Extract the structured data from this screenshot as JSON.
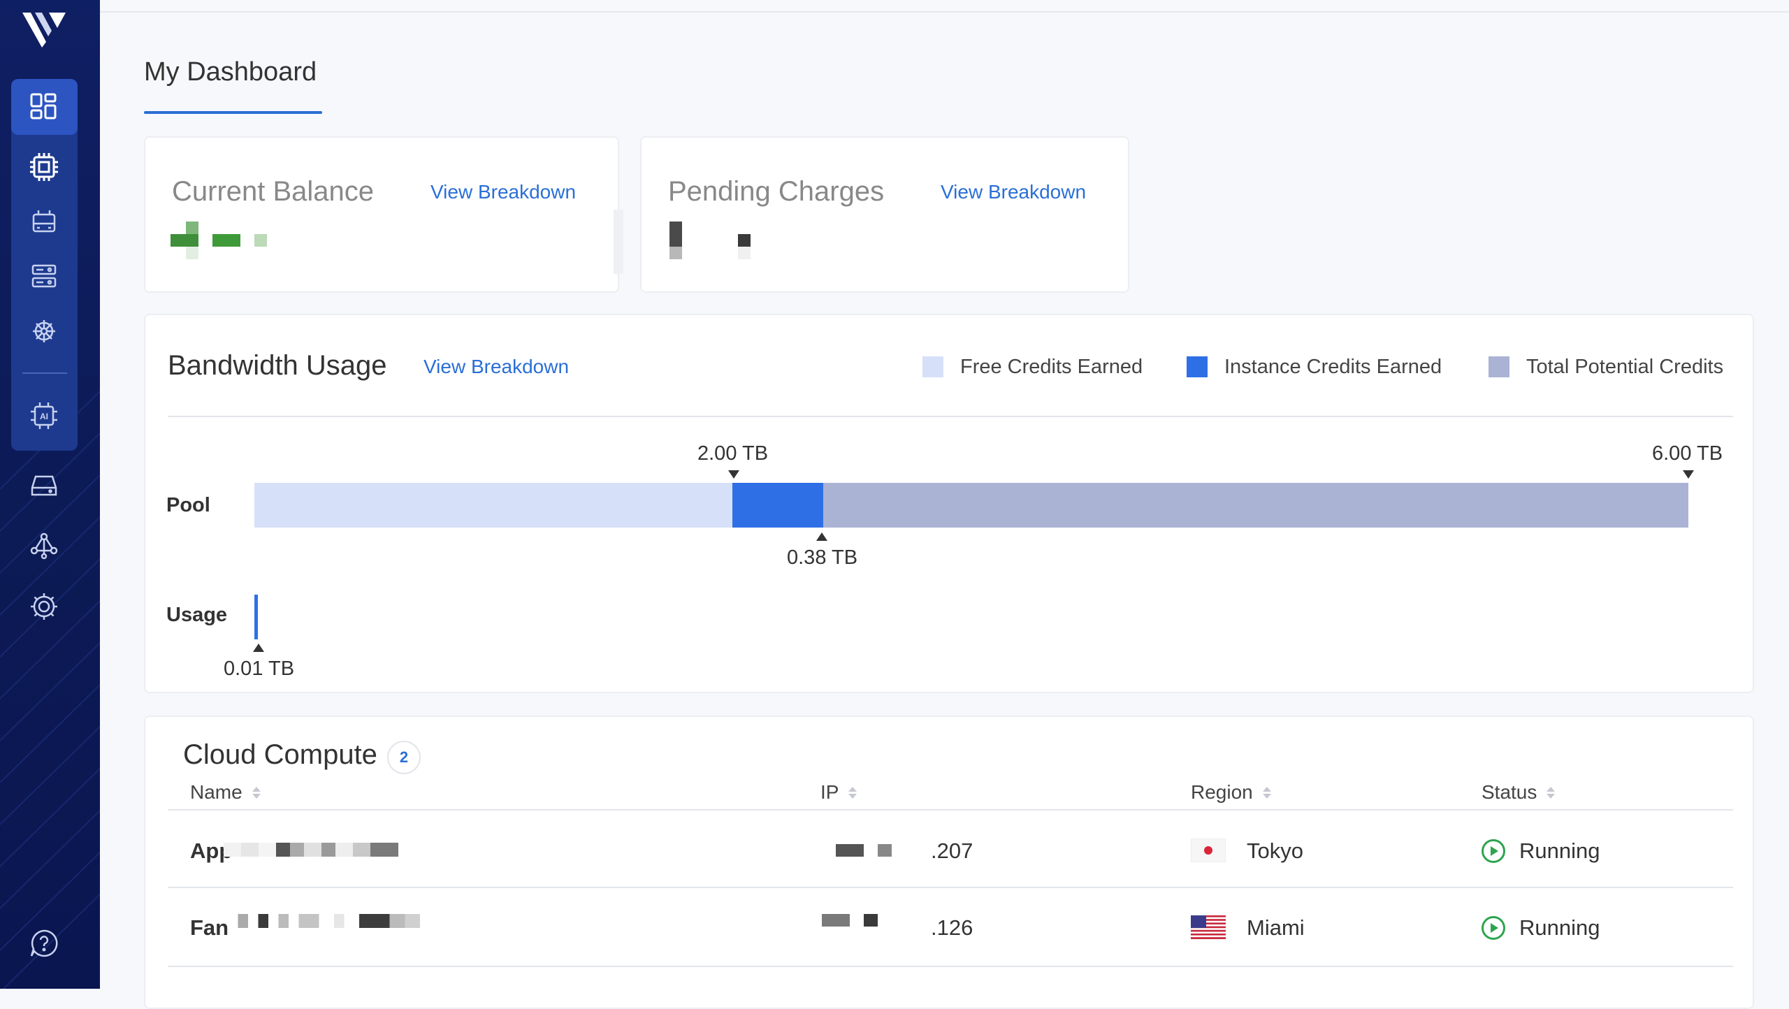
{
  "sidebar": {
    "logo": "vultr-logo",
    "items": [
      {
        "icon": "dashboard-icon",
        "active": true
      },
      {
        "icon": "cpu-icon"
      },
      {
        "icon": "server-icon"
      },
      {
        "icon": "database-icon"
      },
      {
        "icon": "kubernetes-icon"
      },
      {
        "icon": "ai-chip-icon"
      },
      {
        "icon": "storage-icon"
      },
      {
        "icon": "network-icon"
      },
      {
        "icon": "settings-icon"
      },
      {
        "icon": "help-icon"
      }
    ],
    "colors": {
      "background": "#0f1f63",
      "group": "#1d3a8f",
      "active": "#2c55c2"
    }
  },
  "page": {
    "tab_title": "My Dashboard"
  },
  "balance_card": {
    "title": "Current Balance",
    "link": "View Breakdown"
  },
  "pending_card": {
    "title": "Pending Charges",
    "link": "View Breakdown"
  },
  "bandwidth": {
    "title": "Bandwidth Usage",
    "link": "View Breakdown",
    "legend": [
      {
        "label": "Free Credits Earned",
        "color": "#d6e0f8"
      },
      {
        "label": "Instance Credits Earned",
        "color": "#2f6fe6"
      },
      {
        "label": "Total Potential Credits",
        "color": "#aab3d4"
      }
    ],
    "pool_label": "Pool",
    "usage_label": "Usage",
    "marker_free": "2.00 TB",
    "marker_instance": "0.38 TB",
    "marker_total": "6.00 TB",
    "marker_usage": "0.01 TB"
  },
  "chart_data": {
    "type": "bar",
    "orientation": "horizontal",
    "unit": "TB",
    "categories": [
      "Pool",
      "Usage"
    ],
    "series": [
      {
        "name": "Free Credits Earned",
        "values": [
          2.0,
          null
        ]
      },
      {
        "name": "Instance Credits Earned",
        "values": [
          0.38,
          null
        ]
      },
      {
        "name": "Total Potential Credits",
        "values": [
          6.0,
          null
        ]
      },
      {
        "values": [
          null,
          0.01
        ]
      }
    ],
    "xlim": [
      0,
      6.0
    ]
  },
  "cloud_compute": {
    "title": "Cloud Compute",
    "count": "2",
    "columns": [
      "Name",
      "IP",
      "Region",
      "Status"
    ],
    "rows": [
      {
        "name": "App",
        "ip_suffix": ".207",
        "region": "Tokyo",
        "flag": "japan-flag",
        "status": "Running"
      },
      {
        "name": "Fan",
        "ip_suffix": ".126",
        "region": "Miami",
        "flag": "us-flag",
        "status": "Running"
      }
    ]
  }
}
